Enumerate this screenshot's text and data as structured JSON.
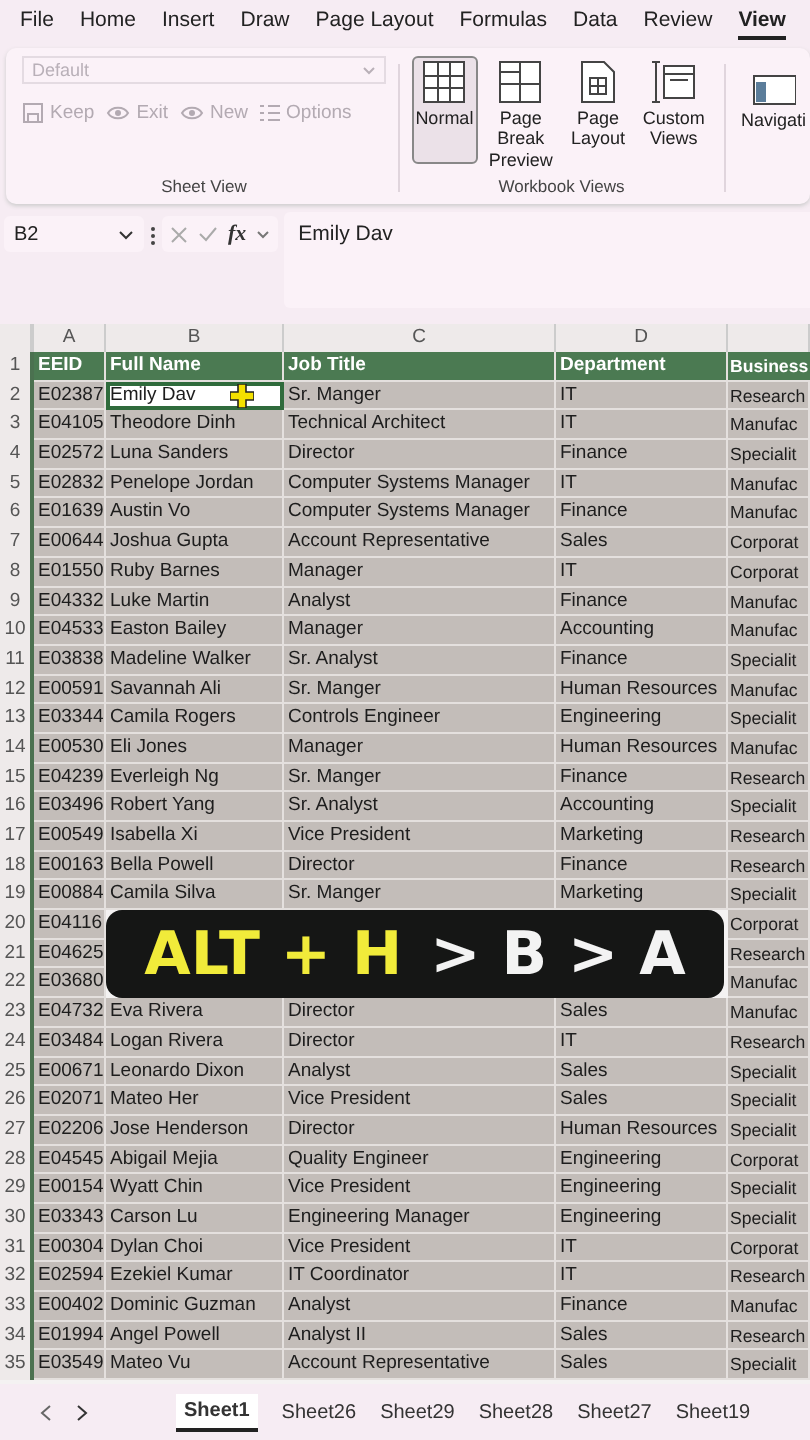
{
  "menu_tabs": [
    {
      "label": "File",
      "selected": false
    },
    {
      "label": "Home",
      "selected": false
    },
    {
      "label": "Insert",
      "selected": false
    },
    {
      "label": "Draw",
      "selected": false
    },
    {
      "label": "Page Layout",
      "selected": false
    },
    {
      "label": "Formulas",
      "selected": false
    },
    {
      "label": "Data",
      "selected": false
    },
    {
      "label": "Review",
      "selected": false
    },
    {
      "label": "View",
      "selected": true
    }
  ],
  "ribbon": {
    "sheet_view": {
      "dropdown": {
        "value": "Default",
        "disabled": true
      },
      "buttons": [
        {
          "kind": "keep",
          "label": "Keep",
          "disabled": true
        },
        {
          "kind": "exit",
          "label": "Exit",
          "disabled": true
        },
        {
          "kind": "new",
          "label": "New",
          "disabled": true
        },
        {
          "kind": "options",
          "label": "Options",
          "disabled": true
        }
      ],
      "label": "Sheet View"
    },
    "workbook_views": {
      "buttons": [
        {
          "kind": "normal",
          "label": "Normal",
          "selected": true
        },
        {
          "kind": "pagebreak",
          "label": "Page Break Preview",
          "selected": false
        },
        {
          "kind": "pagelayout",
          "label": "Page Layout",
          "selected": false
        },
        {
          "kind": "custom",
          "label": "Custom Views",
          "selected": false
        }
      ],
      "label": "Workbook Views"
    },
    "cut_button": {
      "label": "Navigati"
    }
  },
  "formula_bar": {
    "name_box": "B2",
    "fx": "fx",
    "content": "Emily Dav"
  },
  "columns": [
    "A",
    "B",
    "C",
    "D",
    ""
  ],
  "rows": [
    {
      "n": "1",
      "kind": "header",
      "cells": [
        "EEID",
        "Full Name",
        "Job Title",
        "Department",
        "Business"
      ]
    },
    {
      "n": "2",
      "kind": "data",
      "active": true,
      "cells": [
        "E02387",
        "Emily Dav",
        "Sr. Manger",
        "IT",
        "Research"
      ]
    },
    {
      "n": "3",
      "kind": "data",
      "cells": [
        "E04105",
        "Theodore Dinh",
        "Technical Architect",
        "IT",
        "Manufac"
      ]
    },
    {
      "n": "4",
      "kind": "data",
      "cells": [
        "E02572",
        "Luna Sanders",
        "Director",
        "Finance",
        "Specialit"
      ]
    },
    {
      "n": "5",
      "kind": "data",
      "cells": [
        "E02832",
        "Penelope Jordan",
        "Computer Systems Manager",
        "IT",
        "Manufac"
      ]
    },
    {
      "n": "6",
      "kind": "data",
      "cells": [
        "E01639",
        "Austin Vo",
        "Computer Systems Manager",
        "Finance",
        "Manufac"
      ]
    },
    {
      "n": "7",
      "kind": "data",
      "cells": [
        "E00644",
        "Joshua Gupta",
        "Account Representative",
        "Sales",
        "Corporat"
      ]
    },
    {
      "n": "8",
      "kind": "data",
      "cells": [
        "E01550",
        "Ruby Barnes",
        "Manager",
        "IT",
        "Corporat"
      ]
    },
    {
      "n": "9",
      "kind": "data",
      "cells": [
        "E04332",
        "Luke Martin",
        "Analyst",
        "Finance",
        "Manufac"
      ]
    },
    {
      "n": "10",
      "kind": "data",
      "cells": [
        "E04533",
        "Easton Bailey",
        "Manager",
        "Accounting",
        "Manufac"
      ]
    },
    {
      "n": "11",
      "kind": "data",
      "cells": [
        "E03838",
        "Madeline Walker",
        "Sr. Analyst",
        "Finance",
        "Specialit"
      ]
    },
    {
      "n": "12",
      "kind": "data",
      "cells": [
        "E00591",
        "Savannah Ali",
        "Sr. Manger",
        "Human Resources",
        "Manufac"
      ]
    },
    {
      "n": "13",
      "kind": "data",
      "cells": [
        "E03344",
        "Camila Rogers",
        "Controls Engineer",
        "Engineering",
        "Specialit"
      ]
    },
    {
      "n": "14",
      "kind": "data",
      "cells": [
        "E00530",
        "Eli Jones",
        "Manager",
        "Human Resources",
        "Manufac"
      ]
    },
    {
      "n": "15",
      "kind": "data",
      "cells": [
        "E04239",
        "Everleigh Ng",
        "Sr. Manger",
        "Finance",
        "Research"
      ]
    },
    {
      "n": "16",
      "kind": "data",
      "cells": [
        "E03496",
        "Robert Yang",
        "Sr. Analyst",
        "Accounting",
        "Specialit"
      ]
    },
    {
      "n": "17",
      "kind": "data",
      "cells": [
        "E00549",
        "Isabella Xi",
        "Vice President",
        "Marketing",
        "Research"
      ]
    },
    {
      "n": "18",
      "kind": "data",
      "cells": [
        "E00163",
        "Bella Powell",
        "Director",
        "Finance",
        "Research"
      ]
    },
    {
      "n": "19",
      "kind": "data",
      "cells": [
        "E00884",
        "Camila Silva",
        "Sr. Manger",
        "Marketing",
        "Specialit"
      ]
    },
    {
      "n": "20",
      "kind": "data",
      "cells": [
        "E04116",
        null,
        null,
        null,
        "Corporat"
      ]
    },
    {
      "n": "21",
      "kind": "data",
      "cells": [
        "E04625",
        null,
        null,
        null,
        "Research"
      ]
    },
    {
      "n": "22",
      "kind": "data",
      "cells": [
        "E03680",
        null,
        null,
        null,
        "Manufac"
      ]
    },
    {
      "n": "23",
      "kind": "data",
      "cells": [
        "E04732",
        "Eva Rivera",
        "Director",
        "Sales",
        "Manufac"
      ]
    },
    {
      "n": "24",
      "kind": "data",
      "cells": [
        "E03484",
        "Logan Rivera",
        "Director",
        "IT",
        "Research"
      ]
    },
    {
      "n": "25",
      "kind": "data",
      "cells": [
        "E00671",
        "Leonardo Dixon",
        "Analyst",
        "Sales",
        "Specialit"
      ]
    },
    {
      "n": "26",
      "kind": "data",
      "cells": [
        "E02071",
        "Mateo Her",
        "Vice President",
        "Sales",
        "Specialit"
      ]
    },
    {
      "n": "27",
      "kind": "data",
      "cells": [
        "E02206",
        "Jose Henderson",
        "Director",
        "Human Resources",
        "Specialit"
      ]
    },
    {
      "n": "28",
      "kind": "data",
      "cells": [
        "E04545",
        "Abigail Mejia",
        "Quality Engineer",
        "Engineering",
        "Corporat"
      ]
    },
    {
      "n": "29",
      "kind": "data",
      "cells": [
        "E00154",
        "Wyatt Chin",
        "Vice President",
        "Engineering",
        "Specialit"
      ]
    },
    {
      "n": "30",
      "kind": "data",
      "cells": [
        "E03343",
        "Carson Lu",
        "Engineering Manager",
        "Engineering",
        "Specialit"
      ]
    },
    {
      "n": "31",
      "kind": "data",
      "cells": [
        "E00304",
        "Dylan Choi",
        "Vice President",
        "IT",
        "Corporat"
      ]
    },
    {
      "n": "32",
      "kind": "data",
      "cells": [
        "E02594",
        "Ezekiel Kumar",
        "IT Coordinator",
        "IT",
        "Research"
      ]
    },
    {
      "n": "33",
      "kind": "data",
      "cells": [
        "E00402",
        "Dominic Guzman",
        "Analyst",
        "Finance",
        "Manufac"
      ]
    },
    {
      "n": "34",
      "kind": "data",
      "cells": [
        "E01994",
        "Angel Powell",
        "Analyst II",
        "Sales",
        "Research"
      ]
    },
    {
      "n": "35",
      "kind": "data",
      "cells": [
        "E03549",
        "Mateo Vu",
        "Account Representative",
        "Sales",
        "Specialit"
      ]
    }
  ],
  "caption": {
    "highlight": "ALT + H",
    "rest": "> B > A"
  },
  "sheet_tabs": [
    {
      "label": "Sheet1",
      "selected": true
    },
    {
      "label": "Sheet26",
      "selected": false
    },
    {
      "label": "Sheet29",
      "selected": false
    },
    {
      "label": "Sheet28",
      "selected": false
    },
    {
      "label": "Sheet27",
      "selected": false
    },
    {
      "label": "Sheet19",
      "selected": false
    }
  ]
}
